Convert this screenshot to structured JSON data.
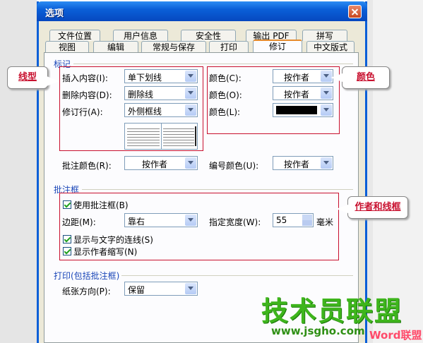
{
  "window": {
    "title": "选项"
  },
  "tabs_back": [
    "文件位置",
    "用户信息",
    "安全性",
    "输出 PDF",
    "拼写"
  ],
  "tabs_front": [
    "视图",
    "编辑",
    "常规与保存",
    "打印",
    "修订",
    "中文版式"
  ],
  "markup": {
    "title": "标记",
    "insert_label": "插入内容(I):",
    "insert_value": "单下划线",
    "delete_label": "删除内容(D):",
    "delete_value": "删除线",
    "revline_label": "修订行(A):",
    "revline_value": "外侧框线",
    "color1_label": "颜色(C):",
    "color1_value": "按作者",
    "color2_label": "颜色(O):",
    "color2_value": "按作者",
    "color3_label": "颜色(L):",
    "color3_swatch": "#000000",
    "comment_color_label": "批注颜色(R):",
    "comment_color_value": "按作者",
    "number_color_label": "编号颜色(U):",
    "number_color_value": "按作者"
  },
  "balloons": {
    "title": "批注框",
    "use_label": "使用批注框(B)",
    "margin_label": "边距(M):",
    "margin_value": "靠右",
    "width_label": "指定宽度(W):",
    "width_value": "55",
    "width_unit": "毫米",
    "show_lines_label": "显示与文字的连线(S)",
    "show_author_label": "显示作者缩写(N)"
  },
  "print": {
    "title": "打印(包括批注框)",
    "orientation_label": "纸张方向(P):",
    "orientation_value": "保留"
  },
  "annotations": {
    "linetype": "线型",
    "color": "颜色",
    "author_and_line": "作者和线框"
  },
  "watermark": {
    "cn": "技术员联盟",
    "url": "www.jsgho.com",
    "suffix": "Word联盟"
  }
}
